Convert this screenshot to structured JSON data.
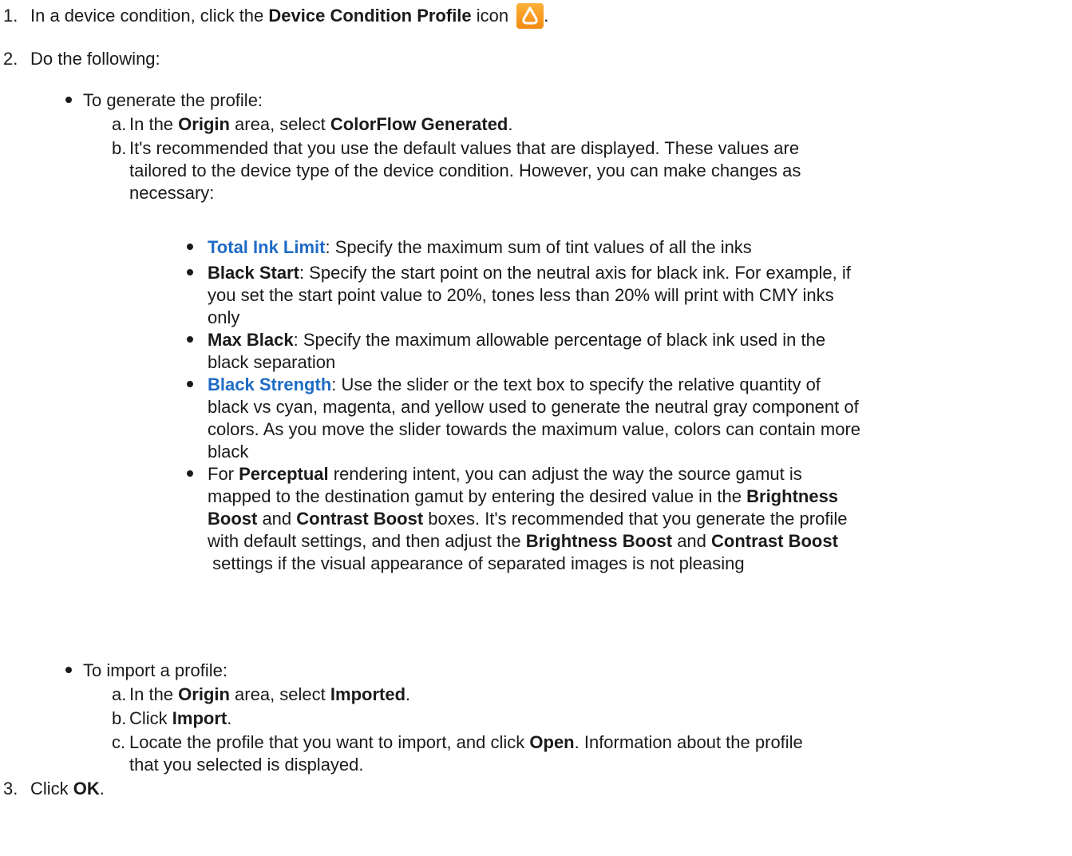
{
  "step1": {
    "num": "1.",
    "prefix": "In a device condition, click the ",
    "bold": "Device Condition Profile",
    "suffix": " icon",
    "end": ".",
    "icon": "device-condition-profile-icon"
  },
  "step2": {
    "num": "2.",
    "text": "Do the following:",
    "generate": {
      "intro": "To generate the profile:",
      "a": {
        "letter": "a.",
        "p1": "In the ",
        "b1": "Origin",
        "p2": " area, select ",
        "b2": "ColorFlow Generated",
        "p3": "."
      },
      "b": {
        "letter": "b.",
        "line1": "It's recommended that you use the default values that are displayed. These values are",
        "line2": "tailored to the device type of the device condition. However, you can make changes as",
        "line3": "necessary:"
      },
      "items": {
        "ink": {
          "term": "Total Ink Limit",
          "line1": ": Specify the maximum sum of tint values of all the inks"
        },
        "start": {
          "term": "Black Start",
          "line1": ": Specify the start point on the neutral axis for black ink. For example, if",
          "line2": "you set the start point value to 20%, tones less than 20% will print with CMY inks",
          "line3": "only"
        },
        "max": {
          "term": "Max Black",
          "line1": ": Specify the maximum allowable percentage of black ink used in the",
          "line2": "black separation"
        },
        "strength": {
          "term": "Black Strength",
          "line1": ": Use the slider or the text box to specify the relative quantity of",
          "line2": "black vs cyan, magenta, and yellow used to generate the neutral gray component of",
          "line3": "colors. As you move the slider towards the maximum value, colors can contain more",
          "line4": "black"
        },
        "perceptual": {
          "l1a": "For ",
          "l1b": "Perceptual",
          "l1c": " rendering intent, you can adjust the way the source gamut is",
          "l2a": "mapped to the destination gamut by entering the desired value in the ",
          "l2b": "Brightness",
          "l3a": "Boost",
          "l3b": " and ",
          "l3c": "Contrast Boost",
          "l3d": " boxes. It's recommended that you generate the profile",
          "l4a": "with default settings, and then adjust the ",
          "l4b": "Brightness Boost",
          "l4c": " and ",
          "l4d": "Contrast Boost",
          "l5": " settings if the visual appearance of separated images is not pleasing"
        }
      }
    },
    "import": {
      "intro": "To import a profile:",
      "a": {
        "letter": "a.",
        "p1": "In the ",
        "b1": "Origin",
        "p2": " area, select ",
        "b2": "Imported",
        "p3": "."
      },
      "b": {
        "letter": "b.",
        "p1": "Click ",
        "b1": "Import",
        "p2": "."
      },
      "c": {
        "letter": "c.",
        "p1": "Locate the profile that you want to import, and click ",
        "b1": "Open",
        "p2": ". Information about the profile",
        "line2": "that you selected is displayed."
      }
    }
  },
  "step3": {
    "num": "3.",
    "p1": "Click ",
    "b1": "OK",
    "p2": "."
  },
  "colors": {
    "link": "#1e6bc6",
    "icon": "#f28a10"
  }
}
